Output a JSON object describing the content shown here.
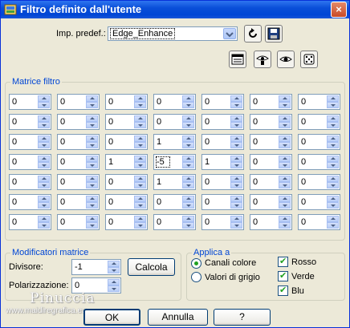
{
  "window": {
    "title": "Filtro definito dall'utente",
    "close_glyph": "×",
    "title_icon": "app-icon"
  },
  "preset": {
    "label": "Imp. predef.:",
    "value": "Edge_Enhance",
    "icons": [
      "reset-arrow-icon",
      "save-disk-icon"
    ]
  },
  "toolbar_icons": [
    "window-toggle-icon",
    "eye-key-icon",
    "eye-icon",
    "dice-icon"
  ],
  "matrix": {
    "legend": "Matrice filtro",
    "rows": [
      [
        "0",
        "0",
        "0",
        "0",
        "0",
        "0",
        "0"
      ],
      [
        "0",
        "0",
        "0",
        "0",
        "0",
        "0",
        "0"
      ],
      [
        "0",
        "0",
        "0",
        "1",
        "0",
        "0",
        "0"
      ],
      [
        "0",
        "0",
        "1",
        "-5",
        "1",
        "0",
        "0"
      ],
      [
        "0",
        "0",
        "0",
        "1",
        "0",
        "0",
        "0"
      ],
      [
        "0",
        "0",
        "0",
        "0",
        "0",
        "0",
        "0"
      ],
      [
        "0",
        "0",
        "0",
        "0",
        "0",
        "0",
        "0"
      ]
    ]
  },
  "modifiers": {
    "legend": "Modificatori matrice",
    "divisor_label": "Divisore:",
    "divisor_value": "-1",
    "calc_label": "Calcola",
    "bias_label": "Polarizzazione:",
    "bias_value": "0"
  },
  "apply": {
    "legend": "Applica a",
    "color_channels": "Canali colore",
    "grey_values": "Valori di grigio",
    "selected": "Canali colore",
    "red": "Rosso",
    "green": "Verde",
    "blue": "Blu",
    "red_checked": true,
    "green_checked": true,
    "blue_checked": true
  },
  "buttons": {
    "ok": "OK",
    "cancel": "Annulla",
    "help": "?"
  },
  "watermark": {
    "name": "Pinuccia",
    "site": "www.maidiregrafica.eu"
  }
}
